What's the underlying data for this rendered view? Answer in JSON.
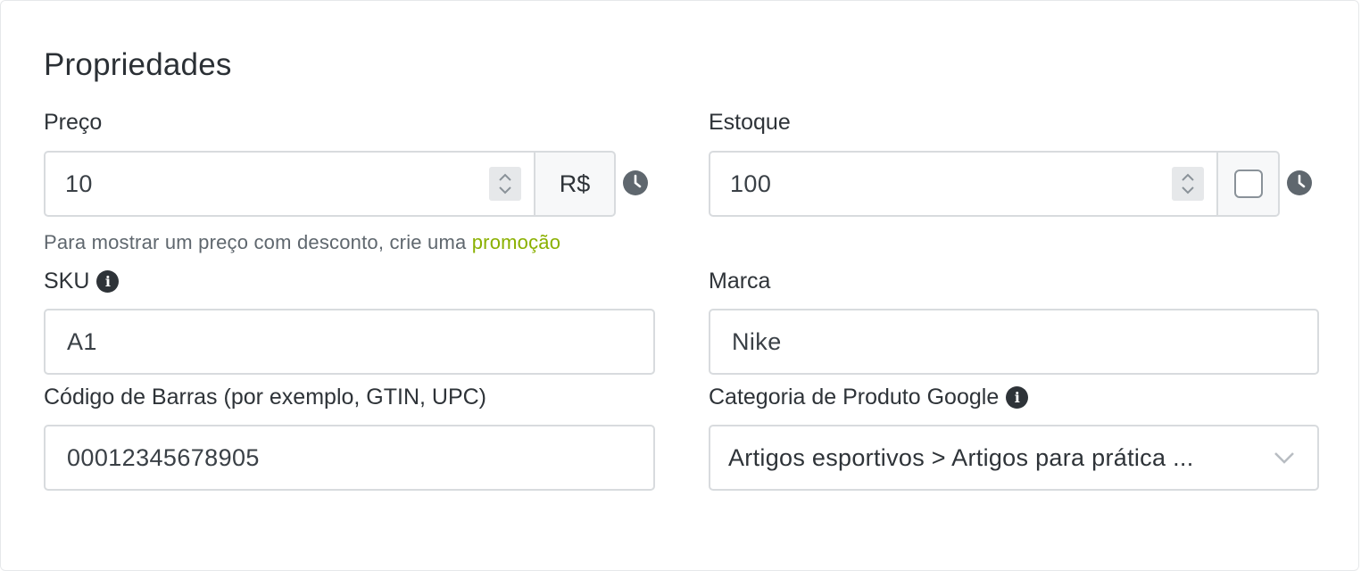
{
  "section": {
    "title": "Propriedades"
  },
  "price": {
    "label": "Preço",
    "value": "10",
    "currency": "R$",
    "help_text": "Para mostrar um preço com desconto, crie uma ",
    "help_link": "promoção"
  },
  "stock": {
    "label": "Estoque",
    "value": "100",
    "unlimited_checked": false
  },
  "sku": {
    "label": "SKU",
    "value": "A1"
  },
  "brand": {
    "label": "Marca",
    "value": "Nike"
  },
  "barcode": {
    "label": "Código de Barras (por exemplo, GTIN, UPC)",
    "value": "00012345678905"
  },
  "google_category": {
    "label": "Categoria de Produto Google",
    "value": "Artigos esportivos > Artigos para prática ..."
  },
  "icons": {
    "schedule": "clock-icon",
    "info": "info-icon",
    "spinner": "up-down-chevron-icon",
    "dropdown": "chevron-down-icon"
  },
  "colors": {
    "link": "#8ab000",
    "text": "#2e3338",
    "border": "#d8dbde",
    "icon": "#5f676e"
  }
}
